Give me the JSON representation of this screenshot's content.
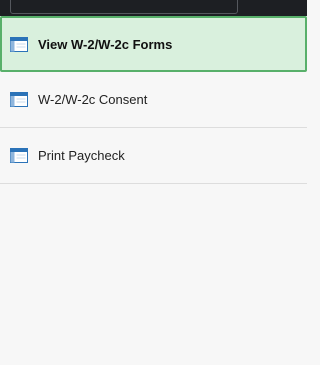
{
  "nav": {
    "items": [
      {
        "label": "View W-2/W-2c Forms",
        "icon": "form-page-icon",
        "selected": true
      },
      {
        "label": "W-2/W-2c Consent",
        "icon": "form-page-icon",
        "selected": false
      },
      {
        "label": "Print Paycheck",
        "icon": "form-page-icon",
        "selected": false
      }
    ]
  },
  "colors": {
    "selected_background": "#d9f0dd",
    "selected_border": "#58b06a",
    "icon_blue": "#2b73b8"
  }
}
